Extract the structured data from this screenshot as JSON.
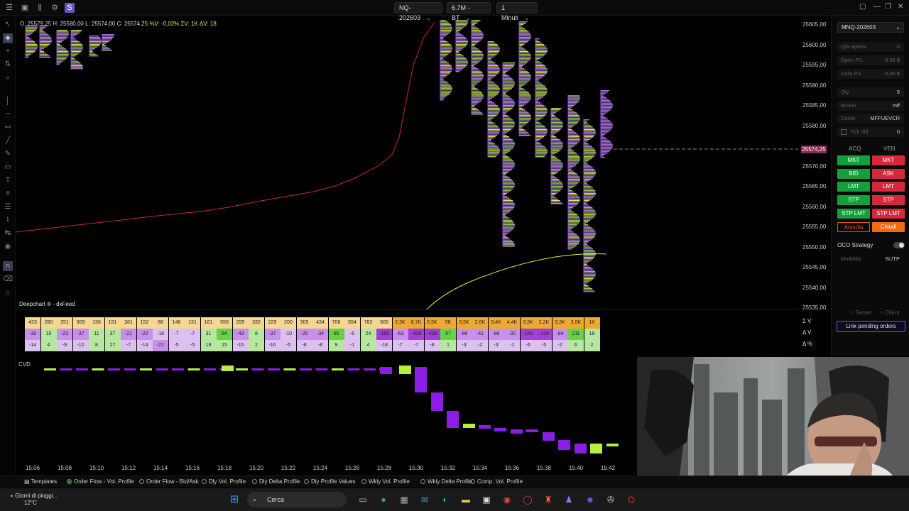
{
  "toolbar": {
    "symbol": "NQ-202603",
    "range": "6.7M - BT",
    "timeframe": "1 Minuti"
  },
  "ohlc": {
    "open": "O: 25579,25",
    "high": "H: 25580,00",
    "low": "L: 25574,00",
    "close": "C: 25574,25",
    "stats": "%V: -0,02%  ΣV: 1K  ΔV: 18"
  },
  "chart": {
    "watermark": "Deepchart ® - dxFeed",
    "current_price": "25574,25",
    "price_labels": [
      "25605,00",
      "25600,00",
      "25595,00",
      "25590,00",
      "25585,00",
      "25580,00",
      "25570,00",
      "25565,00",
      "25560,00",
      "25555,00",
      "25550,00",
      "25545,00",
      "25540,00",
      "25535,00"
    ],
    "stat_labels": [
      "Σ V",
      "Δ V",
      "Δ %"
    ]
  },
  "stats_table": {
    "row_v": [
      "423",
      "260",
      "251",
      "309",
      "136",
      "191",
      "281",
      "152",
      "86",
      "146",
      "131",
      "161",
      "556",
      "295",
      "332",
      "229",
      "200",
      "305",
      "434",
      "706",
      "554",
      "782",
      "905",
      "2,3K",
      "8,7K",
      "5,5K",
      "5K",
      "3,5K",
      "2,6K",
      "3,4K",
      "4,4K",
      "3,3K",
      "2,2K",
      "3,3K",
      "3,5K",
      "1K"
    ],
    "row_dv": [
      "-39",
      "10",
      "-23",
      "-37",
      "11",
      "37",
      "-21",
      "-22",
      "-18",
      "-7",
      "-7",
      "31",
      "84",
      "-43",
      "8",
      "-37",
      "-10",
      "-25",
      "-34",
      "66",
      "-6",
      "24",
      "-165",
      "-63",
      "-408",
      "-438",
      "57",
      "-86",
      "-41",
      "-86",
      "-30",
      "-143",
      "-118",
      "-84",
      "211",
      "18"
    ],
    "row_dp": [
      "-14",
      "4",
      "-9",
      "-12",
      "8",
      "27",
      "-7",
      "-14",
      "-21",
      "-5",
      "-5",
      "19",
      "15",
      "-15",
      "2",
      "-16",
      "-5",
      "-8",
      "-8",
      "9",
      "-1",
      "4",
      "-18",
      "-7",
      "-7",
      "-8",
      "1",
      "-3",
      "-2",
      "-3",
      "-1",
      "-6",
      "-5",
      "-2",
      "6",
      "2"
    ]
  },
  "cvd": {
    "label": "CVD"
  },
  "time_axis": [
    "15:06",
    "15:08",
    "15:10",
    "15:12",
    "15:14",
    "15:16",
    "15:18",
    "15:20",
    "15:22",
    "15:24",
    "15:26",
    "15:28",
    "15:30",
    "15:32",
    "15:34",
    "15:36",
    "15:38",
    "15:40",
    "15:42"
  ],
  "templates": {
    "label": "Templates",
    "items": [
      "Order Flow - Vol. Profile",
      "Order Flow - Bid/Ask",
      "Dly Vol. Profile",
      "Dly Delta Profile",
      "Dly Profile Values",
      "Wkly Vol. Profile",
      "Wkly Delta Profile",
      "Comp. Vol. Profile"
    ],
    "selected_index": 0
  },
  "order_panel": {
    "symbol": "MNQ-202603",
    "qta_aperta": "Qtà aperta",
    "qta_aperta_val": "0",
    "open_pl": "Open P/L",
    "open_pl_val": "0,00 $",
    "daily_pl": "Daily P/L",
    "daily_pl_val": "0,00 $",
    "qty": "Qty",
    "qty_val": "5",
    "broker": "Broker",
    "broker_val": "mff",
    "conto": "Conto",
    "conto_val": "MFFUEVCR",
    "tick_diff": "Tick diff.",
    "tick_diff_val": "0",
    "acq": "ACQ.",
    "ven": "VEN.",
    "buy_buttons": [
      "MKT",
      "BID",
      "LMT",
      "STP",
      "STP LMT"
    ],
    "sell_buttons": [
      "MKT",
      "ASK",
      "LMT",
      "STP",
      "STP LMT"
    ],
    "cancel": "Annulla",
    "close": "Chiudi",
    "oco": "OCO Strategy",
    "modalita": "Modalità",
    "modalita_val": "SL/TP",
    "server": "Server",
    "client": "Client",
    "link_pending": "Link pending orders"
  },
  "taskbar": {
    "weather_title": "Giorni di pioggi...",
    "weather_temp": "12°C",
    "search": "Cerca"
  },
  "colors": {
    "buy": "#13a03a",
    "sell": "#d4283c",
    "cvd_up": "#b6f03a",
    "cvd_down": "#8a1ee6",
    "vwap": "#c8283c",
    "yellow_line": "#e6e64a"
  }
}
